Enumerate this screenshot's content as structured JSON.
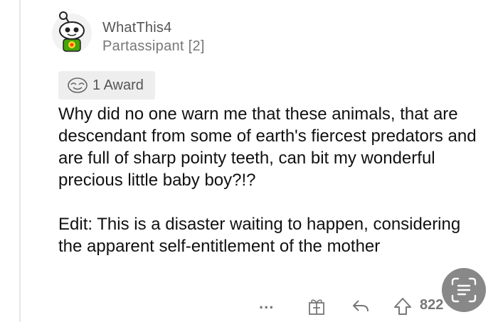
{
  "comment": {
    "username": "WhatThis4",
    "flair": "Partassipant [2]",
    "award_label": "1 Award",
    "paragraphs": [
      "Why did no one warn me that these animals, that are descendant from some of earth's fiercest predators and are full of sharp pointy teeth, can bit my wonderful precious little baby boy?!?",
      "Edit: This is a disaster waiting to happen, considering the apparent self-entitlement of the mother"
    ]
  },
  "actions": {
    "more_label": "...",
    "score": "822",
    "icons": [
      "gift-icon",
      "reply-icon",
      "upvote-icon",
      "text-scan-icon"
    ]
  }
}
